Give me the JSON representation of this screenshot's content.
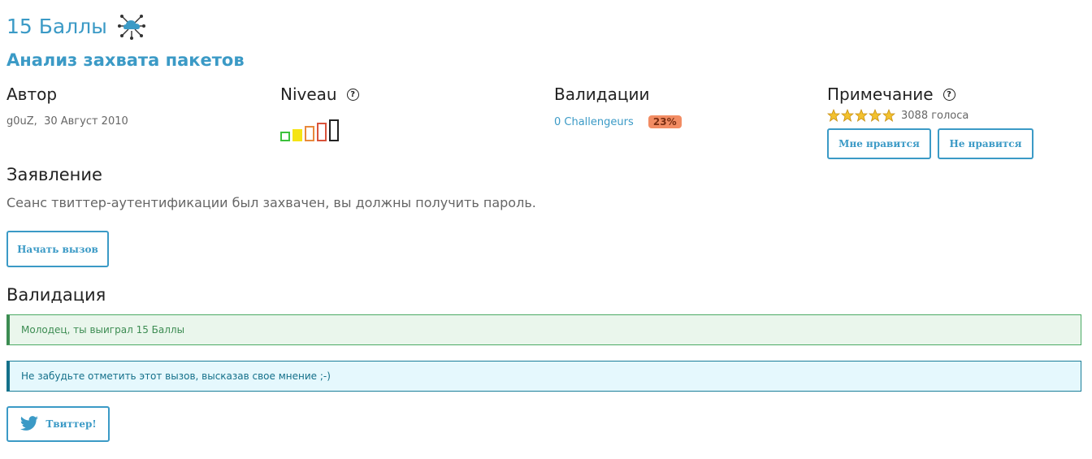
{
  "header": {
    "points_title": "15 Баллы",
    "challenge_title": "Анализ захвата пакетов",
    "category_icon": "cloud-network-icon"
  },
  "author": {
    "heading": "Автор",
    "name": "g0uZ",
    "date": "30 Август 2010"
  },
  "level": {
    "heading": "Niveau",
    "help_glyph": "?",
    "value_of_five": 2
  },
  "validations": {
    "heading": "Валидации",
    "challengers": "0 Challengeurs",
    "percent": "23%"
  },
  "rating": {
    "heading": "Примечание",
    "help_glyph": "?",
    "stars": 5,
    "votes": "3088 голоса",
    "like_label": "Мне нравится",
    "dislike_label": "Не нравится"
  },
  "statement": {
    "heading": "Заявление",
    "text": "Сеанс твиттер-аутентификации был захвачен, вы должны получить пароль.",
    "start_label": "Начать вызов"
  },
  "validation": {
    "heading": "Валидация",
    "success_message": "Молодец, ты выиграл 15 Баллы",
    "info_message": "Не забудьте отметить этот вызов, высказав свое мнение ;-)"
  },
  "share": {
    "twitter_label": "Твиттер!"
  },
  "colors": {
    "accent": "#3b9ac6",
    "badge": "#f28c63",
    "success": "#3c8c52",
    "info": "#14708a",
    "levels": [
      "#3cc13c",
      "#f5e414",
      "#e8893c",
      "#d9533b",
      "#222222"
    ]
  }
}
